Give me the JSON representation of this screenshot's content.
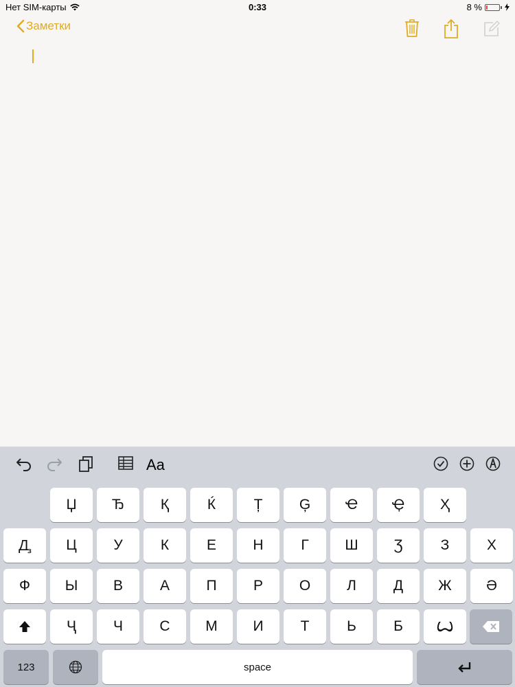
{
  "status_bar": {
    "carrier": "Нет SIM-карты",
    "time": "0:33",
    "battery": "8 %",
    "battery_level": 0.08
  },
  "nav": {
    "back_label": "Заметки"
  },
  "colors": {
    "accent": "#e0ac21",
    "key_bg": "#ffffff",
    "func_key_bg": "#aeb3bd",
    "keyboard_bg": "#d1d4db",
    "battery_low": "#e53935"
  },
  "toolbar": {
    "format_label": "Aa"
  },
  "keyboard": {
    "row1": [
      "Џ",
      "Ђ",
      "Қ",
      "Ќ",
      "Ț",
      "Ģ",
      "Ҽ",
      "Ҿ",
      "Ҳ"
    ],
    "row2": [
      "Ꚉ",
      "Ц",
      "У",
      "К",
      "Е",
      "Н",
      "Г",
      "Ш",
      "Ʒ",
      "З",
      "Х"
    ],
    "row3": [
      "Ф",
      "Ы",
      "В",
      "А",
      "П",
      "Р",
      "О",
      "Л",
      "Д",
      "Ж",
      "Ә"
    ],
    "row4": [
      "Ҷ",
      "Ч",
      "С",
      "М",
      "И",
      "Т",
      "Ь",
      "Б",
      "Ꙍ"
    ],
    "numbers_label": "123",
    "space_label": "space"
  }
}
